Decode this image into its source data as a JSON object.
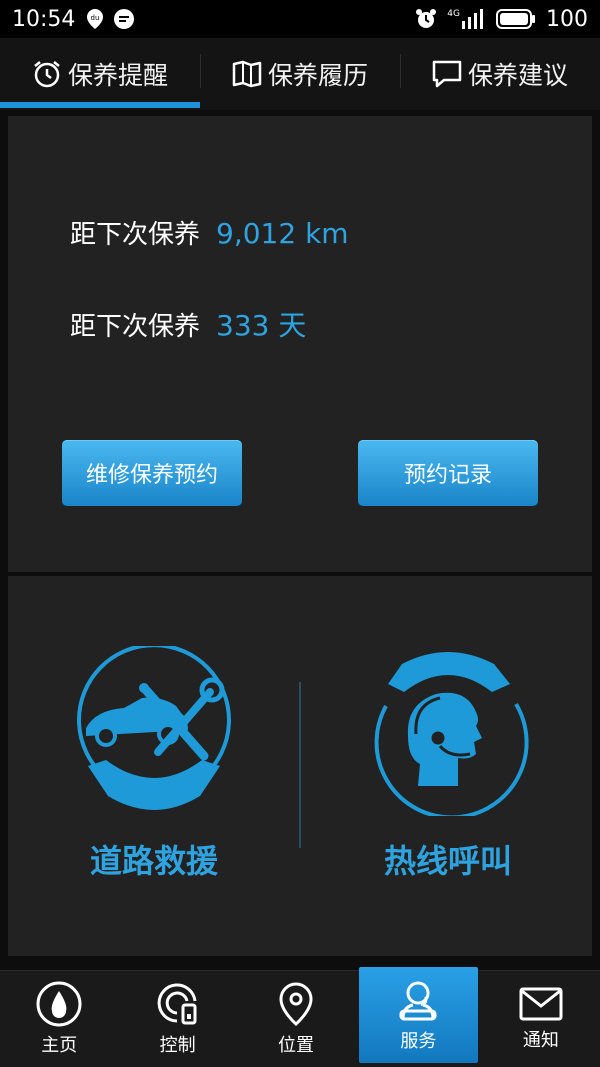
{
  "statusbar": {
    "time": "10:54",
    "network": "4G",
    "battery": "100"
  },
  "tabs": [
    {
      "label": "保养提醒",
      "icon": "alarm-clock-icon",
      "active": true
    },
    {
      "label": "保养履历",
      "icon": "book-icon",
      "active": false
    },
    {
      "label": "保养建议",
      "icon": "chat-bubble-icon",
      "active": false
    }
  ],
  "maintenance": {
    "distance_label": "距下次保养",
    "distance_value": "9,012 km",
    "days_label": "距下次保养",
    "days_value": "333 天",
    "appointment_button": "维修保养预约",
    "records_button": "预约记录"
  },
  "services": {
    "roadside": {
      "label": "道路救援",
      "icon": "roadside-assistance-icon"
    },
    "hotline": {
      "label": "热线呼叫",
      "icon": "hotline-agent-icon"
    }
  },
  "bottomnav": [
    {
      "label": "主页",
      "icon": "home-drop-icon",
      "active": false
    },
    {
      "label": "控制",
      "icon": "remote-control-icon",
      "active": false
    },
    {
      "label": "位置",
      "icon": "location-pin-icon",
      "active": false
    },
    {
      "label": "服务",
      "icon": "service-agent-icon",
      "active": true
    },
    {
      "label": "通知",
      "icon": "mail-icon",
      "active": false
    }
  ],
  "colors": {
    "accent": "#2ea3e0",
    "panel": "#222222",
    "background": "#0d0d0d"
  }
}
